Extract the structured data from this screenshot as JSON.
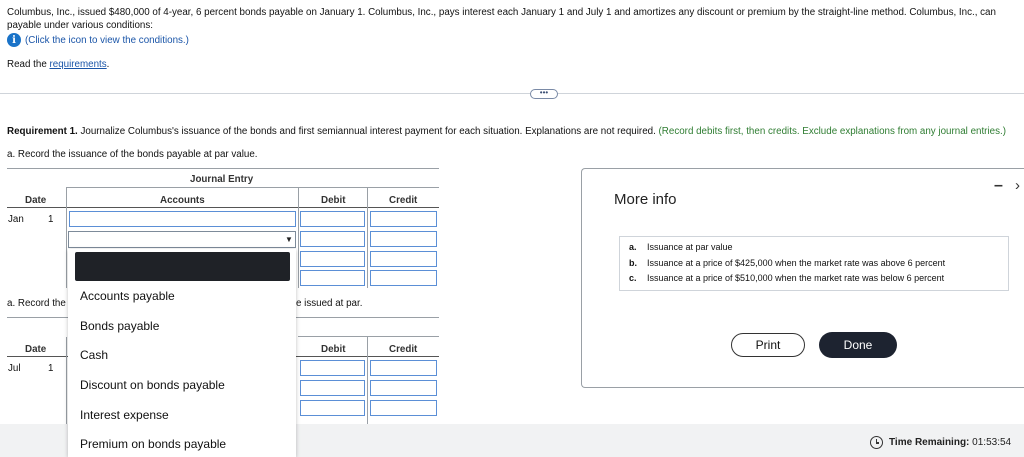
{
  "problem": {
    "line1": "Columbus, Inc., issued $480,000 of 4-year, 6 percent bonds payable on January 1. Columbus, Inc., pays interest each January 1 and July 1 and amortizes any discount or premium by the straight-line method. Columbus, Inc., can",
    "line2": "payable under various conditions:",
    "info_link": "(Click the icon to view the conditions.)",
    "read_prefix": "Read the ",
    "read_link": "requirements",
    "read_suffix": "."
  },
  "expand_pill": "•••",
  "requirement": {
    "label": "Requirement 1.",
    "text": " Journalize Columbus's issuance of the bonds and first semiannual interest payment for each situation. Explanations are not required. ",
    "hint": "(Record debits first, then credits. Exclude explanations from any journal entries.)",
    "sub_a": "a. Record the issuance of the bonds payable at par value.",
    "sub_a2_left": "a. Record the",
    "sub_a2_right": "e issued at par."
  },
  "journal1": {
    "title": "Journal Entry",
    "headers": [
      "Date",
      "Accounts",
      "Debit",
      "Credit"
    ],
    "month": "Jan",
    "day": "1"
  },
  "journal2": {
    "headers": [
      "Date",
      "Debit",
      "Credit"
    ],
    "month": "Jul",
    "day": "1"
  },
  "dropdown": {
    "selected": "",
    "options": [
      "Accounts payable",
      "Bonds payable",
      "Cash",
      "Discount on bonds payable",
      "Interest expense",
      "Premium on bonds payable"
    ]
  },
  "modal": {
    "title": "More info",
    "conditions": [
      {
        "letter": "a.",
        "text": "Issuance at par value"
      },
      {
        "letter": "b.",
        "text": "Issuance at a price of $425,000 when the market rate was above 6 percent"
      },
      {
        "letter": "c.",
        "text": "Issuance at a price of $510,000 when the market rate was below 6 percent"
      }
    ],
    "print": "Print",
    "done": "Done",
    "minimize": "–",
    "close": "›"
  },
  "timer": {
    "label": "Time Remaining:",
    "value": "01:53:54"
  },
  "colors": {
    "accent_blue": "#1a73c8",
    "hint_green": "#2f7d32",
    "done_button": "#1d2330",
    "input_border": "#5b8fd6"
  }
}
